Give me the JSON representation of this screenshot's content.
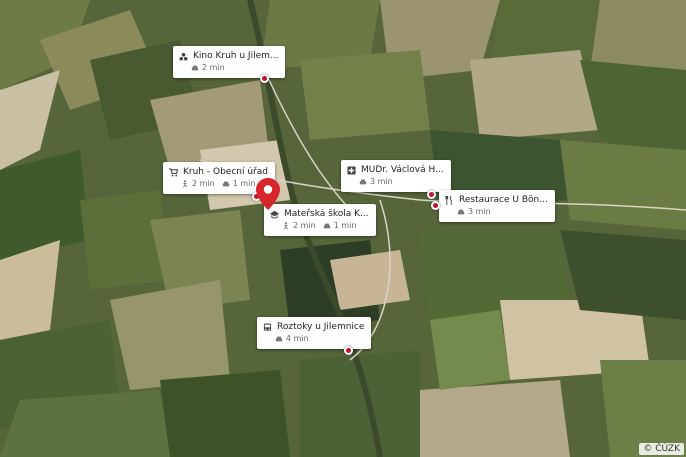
{
  "map": {
    "attribution": "© ČÚZK",
    "colors": {
      "pin": "#d6262b",
      "label_bg": "#ffffff",
      "marker": "#c8102e"
    }
  },
  "pois": [
    {
      "id": "kino",
      "icon": "cinema-icon",
      "name": "Kino Kruh u Jilem...",
      "walk": "",
      "car": "2 min"
    },
    {
      "id": "obecni-urad",
      "icon": "cart-icon",
      "name": "Kruh - Obecní úřad",
      "walk": "2 min",
      "car": "1 min"
    },
    {
      "id": "skola",
      "icon": "school-icon",
      "name": "Mateřská škola K...",
      "walk": "2 min",
      "car": "1 min"
    },
    {
      "id": "mudr",
      "icon": "medical-icon",
      "name": "MUDr. Václová H...",
      "walk": "",
      "car": "3 min"
    },
    {
      "id": "restaurace",
      "icon": "restaurant-icon",
      "name": "Restaurace U Bön...",
      "walk": "",
      "car": "3 min"
    },
    {
      "id": "roztoky",
      "icon": "bus-icon",
      "name": "Roztoky u Jilemnice",
      "walk": "",
      "car": "4 min"
    }
  ]
}
